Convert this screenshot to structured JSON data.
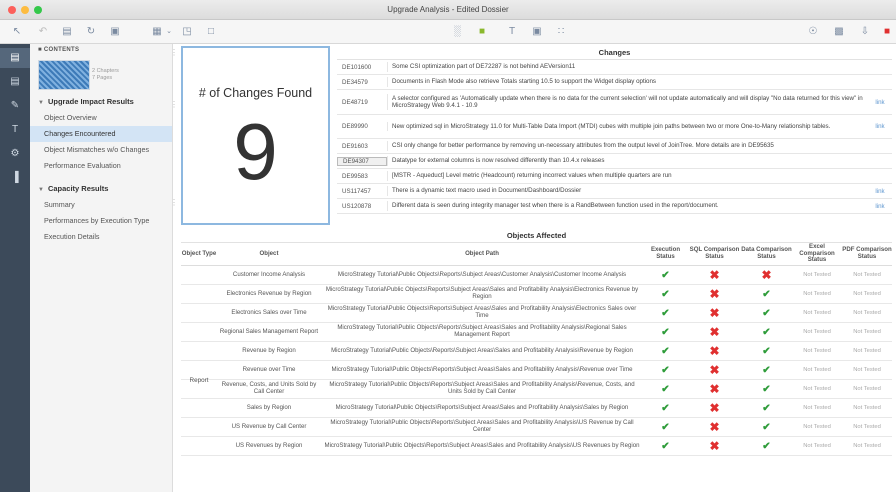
{
  "window": {
    "title": "Upgrade Analysis - Edited Dossier"
  },
  "colors": {
    "accent": "#3d7ab8",
    "check": "#2e9c3a",
    "cross": "#e03030",
    "rail": "#3c4a5a"
  },
  "sidebar": {
    "header": "CONTENTS",
    "thumb_meta": [
      "2 Chapters",
      "7 Pages"
    ],
    "sections": [
      {
        "label": "Upgrade Impact Results",
        "items": [
          "Object Overview",
          "Changes Encountered",
          "Object Mismatches w/o Changes",
          "Performance Evaluation"
        ]
      },
      {
        "label": "Capacity Results",
        "items": [
          "Summary",
          "Performances by Execution Type",
          "Execution Details"
        ]
      }
    ]
  },
  "card": {
    "title": "# of Changes Found",
    "value": "9"
  },
  "changes": {
    "title": "Changes",
    "rows": [
      {
        "id": "DE101600",
        "desc": "Some CSI optimization part of DE72287 is not behind AEVersion11",
        "link": ""
      },
      {
        "id": "DE34579",
        "desc": "Documents in Flash Mode also retrieve Totals starting 10.5 to support the Widget display options",
        "link": ""
      },
      {
        "id": "DE48719",
        "desc": "A selector configured as 'Automatically update when there is no data for the current selection' will not update automatically and will display \"No data returned for this view\" in MicroStrategy Web 9.4.1 - 10.9",
        "link": "link"
      },
      {
        "id": "DE89990",
        "desc": "New optimized sql in MicroStrategy 11.0 for Multi-Table Data Import (MTDI) cubes with multiple join paths between two or more One-to-Many relationship tables.",
        "link": "link"
      },
      {
        "id": "DE91603",
        "desc": "CSI only change for better performance by removing un-necessary attributes from the output level of JoinTree. More details are in DE95635",
        "link": ""
      },
      {
        "id": "DE94307",
        "desc": "Datatype for external columns is now resolved differently than 10.4.x releases",
        "link": ""
      },
      {
        "id": "DE99583",
        "desc": "[MSTR - Aqueduct] Level metric (Headcount) returning incorrect values when multiple quarters are run",
        "link": ""
      },
      {
        "id": "US117457",
        "desc": "There is a dynamic text macro used in Document/Dashboard/Dossier",
        "link": "link"
      },
      {
        "id": "US120878",
        "desc": "Different data is seen during integrity manager test when there is a RandBetween function used in the report/document.",
        "link": "link"
      }
    ]
  },
  "affected": {
    "title": "Objects Affected",
    "headers": [
      "Object Type",
      "Object",
      "Object Path",
      "Execution Status",
      "SQL Comparison Status",
      "Data Comparison Status",
      "Excel Comparison Status",
      "PDF Comparison Status"
    ],
    "type_label": "Report",
    "rows": [
      {
        "object": "Customer Income Analysis",
        "path": "MicroStrategy Tutorial\\Public Objects\\Reports\\Subject Areas\\Customer Analysis\\Customer Income Analysis",
        "exec": "check",
        "sql": "cross",
        "data": "cross",
        "excel": "Not Tested",
        "pdf": "Not Tested"
      },
      {
        "object": "Electronics Revenue by Region",
        "path": "MicroStrategy Tutorial\\Public Objects\\Reports\\Subject Areas\\Sales and Profitability Analysis\\Electronics Revenue by Region",
        "exec": "check",
        "sql": "cross",
        "data": "check",
        "excel": "Not Tested",
        "pdf": "Not Tested"
      },
      {
        "object": "Electronics Sales over Time",
        "path": "MicroStrategy Tutorial\\Public Objects\\Reports\\Subject Areas\\Sales and Profitability Analysis\\Electronics Sales over Time",
        "exec": "check",
        "sql": "cross",
        "data": "check",
        "excel": "Not Tested",
        "pdf": "Not Tested"
      },
      {
        "object": "Regional Sales Management Report",
        "path": "MicroStrategy Tutorial\\Public Objects\\Reports\\Subject Areas\\Sales and Profitability Analysis\\Regional Sales Management Report",
        "exec": "check",
        "sql": "cross",
        "data": "check",
        "excel": "Not Tested",
        "pdf": "Not Tested"
      },
      {
        "object": "Revenue by Region",
        "path": "MicroStrategy Tutorial\\Public Objects\\Reports\\Subject Areas\\Sales and Profitability Analysis\\Revenue by Region",
        "exec": "check",
        "sql": "cross",
        "data": "check",
        "excel": "Not Tested",
        "pdf": "Not Tested"
      },
      {
        "object": "Revenue over Time",
        "path": "MicroStrategy Tutorial\\Public Objects\\Reports\\Subject Areas\\Sales and Profitability Analysis\\Revenue over Time",
        "exec": "check",
        "sql": "cross",
        "data": "check",
        "excel": "Not Tested",
        "pdf": "Not Tested"
      },
      {
        "object": "Revenue, Costs, and Units Sold by Call Center",
        "path": "MicroStrategy Tutorial\\Public Objects\\Reports\\Subject Areas\\Sales and Profitability Analysis\\Revenue, Costs, and Units Sold by Call Center",
        "exec": "check",
        "sql": "cross",
        "data": "check",
        "excel": "Not Tested",
        "pdf": "Not Tested"
      },
      {
        "object": "Sales by Region",
        "path": "MicroStrategy Tutorial\\Public Objects\\Reports\\Subject Areas\\Sales and Profitability Analysis\\Sales by Region",
        "exec": "check",
        "sql": "cross",
        "data": "check",
        "excel": "Not Tested",
        "pdf": "Not Tested"
      },
      {
        "object": "US Revenue by Call Center",
        "path": "MicroStrategy Tutorial\\Public Objects\\Reports\\Subject Areas\\Sales and Profitability Analysis\\US Revenue by Call Center",
        "exec": "check",
        "sql": "cross",
        "data": "check",
        "excel": "Not Tested",
        "pdf": "Not Tested"
      },
      {
        "object": "US Revenues by Region",
        "path": "MicroStrategy Tutorial\\Public Objects\\Reports\\Subject Areas\\Sales and Profitability Analysis\\US Revenues by Region",
        "exec": "check",
        "sql": "cross",
        "data": "check",
        "excel": "Not Tested",
        "pdf": "Not Tested"
      }
    ]
  }
}
